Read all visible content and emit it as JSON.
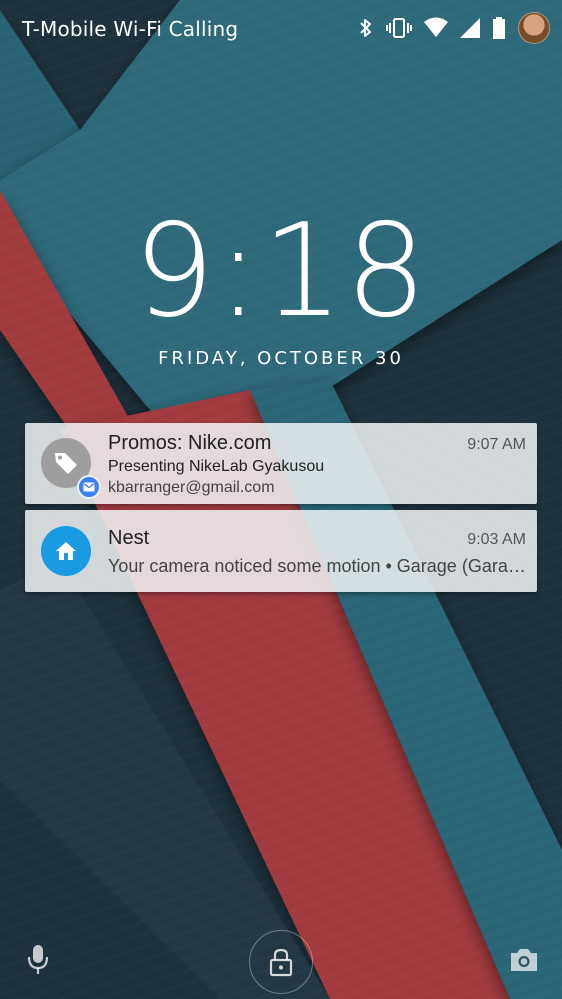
{
  "statusbar": {
    "carrier": "T-Mobile Wi-Fi Calling",
    "icons": [
      "bluetooth-icon",
      "vibrate-icon",
      "wifi-icon",
      "signal-icon",
      "battery-icon",
      "avatar"
    ]
  },
  "lockscreen": {
    "time": "9:18",
    "date": "FRIDAY, OCTOBER 30"
  },
  "notifications": [
    {
      "app_icon": "tag-icon",
      "badge_icon": "mail-icon",
      "title": "Promos: Nike.com",
      "time": "9:07 AM",
      "line1": "Presenting NikeLab Gyakusou",
      "line2": "kbarranger@gmail.com",
      "icon_color": "#9e9e9e"
    },
    {
      "app_icon": "home-icon",
      "title": "Nest",
      "time": "9:03 AM",
      "line1": "Your camera noticed some motion • Garage (Garage camera)",
      "icon_color": "#1a9ae0"
    }
  ],
  "bottom_bar": {
    "left": "microphone-icon",
    "center": "unlock-icon",
    "right": "camera-icon"
  },
  "colors": {
    "teal": "#2d6a7a",
    "red": "#a63a3e",
    "dark": "#1f3440"
  }
}
